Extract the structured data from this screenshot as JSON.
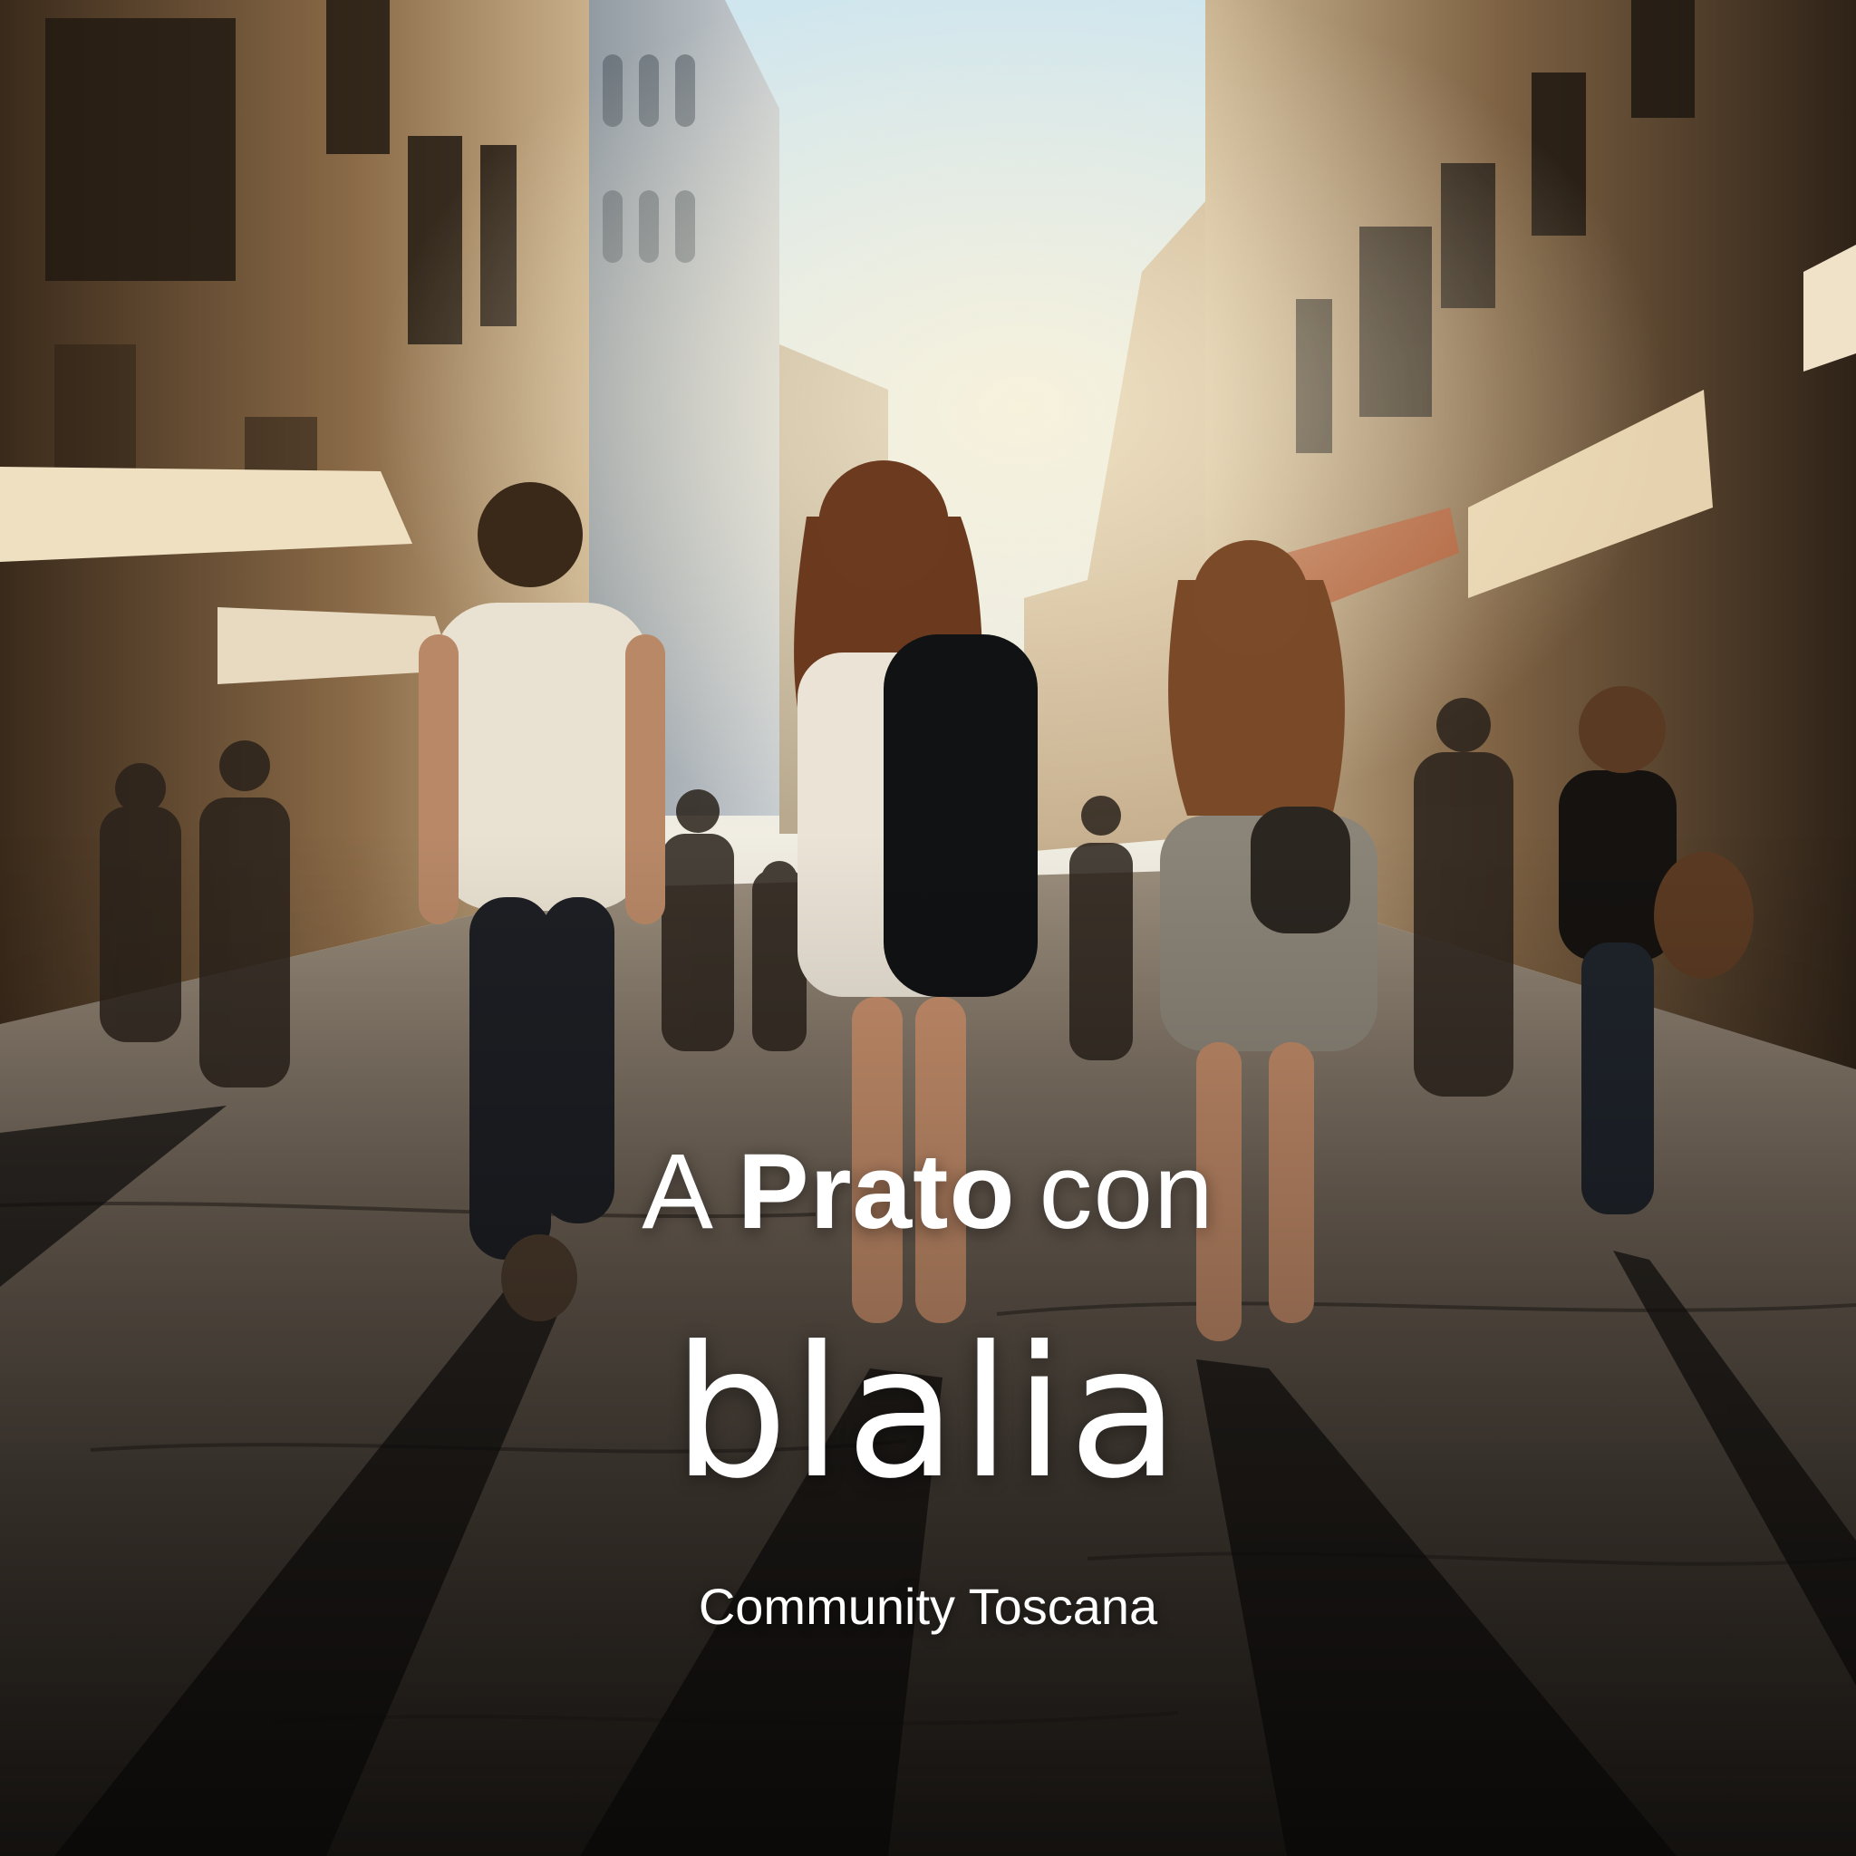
{
  "headline": {
    "prefix": "A",
    "city": "Prato",
    "suffix": "con"
  },
  "brand": "blalia",
  "subtitle": "Community Toscana",
  "palette": {
    "sky": "#dfeef2",
    "sunlight": "#f3dcae",
    "buildings": "#7a5a38",
    "shadow": "#141210",
    "pavement": "#5b5147",
    "text": "#ffffff"
  }
}
